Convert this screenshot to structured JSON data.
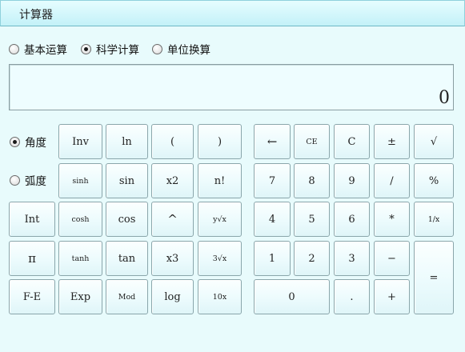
{
  "window": {
    "title": "计算器"
  },
  "modes": [
    {
      "label": "基本运算",
      "checked": false
    },
    {
      "label": "科学计算",
      "checked": true
    },
    {
      "label": "单位换算",
      "checked": false
    }
  ],
  "display": {
    "value": "0"
  },
  "angle_units": [
    {
      "label": "角度",
      "checked": true
    },
    {
      "label": "弧度",
      "checked": false
    }
  ],
  "sci_keys": [
    [
      "Inv",
      "ln",
      "(",
      ")"
    ],
    [
      "sinh",
      "sin",
      "x2",
      "n!"
    ],
    [
      "Int",
      "cosh",
      "cos",
      "^",
      "y√x"
    ],
    [
      "π",
      "tanh",
      "tan",
      "x3",
      "3√x"
    ],
    [
      "F-E",
      "Exp",
      "Mod",
      "log",
      "10x"
    ]
  ],
  "num_keys": [
    [
      "←",
      "CE",
      "C",
      "±",
      "√"
    ],
    [
      "7",
      "8",
      "9",
      "/",
      "%"
    ],
    [
      "4",
      "5",
      "6",
      "*",
      "1/x"
    ],
    [
      "1",
      "2",
      "3",
      "−",
      "="
    ],
    [
      "0",
      ".",
      "+"
    ]
  ]
}
